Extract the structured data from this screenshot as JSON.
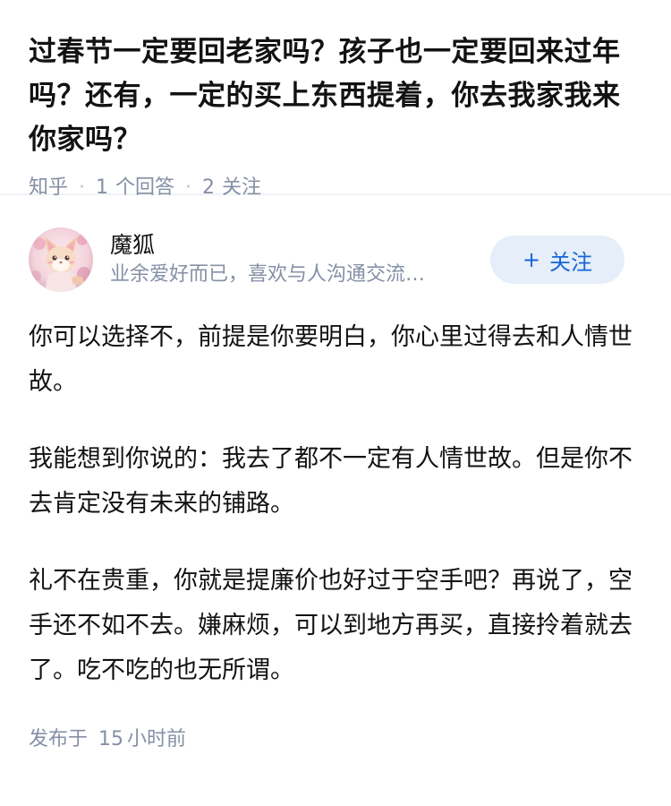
{
  "question": {
    "title": "过春节一定要回老家吗？孩子也一定要回来过年吗？还有，一定的买上东西提着，你去我家我来你家吗？",
    "source": "知乎",
    "answer_count": "1",
    "answer_label": "个回答",
    "follow_count": "2",
    "follow_label": "关注"
  },
  "answer": {
    "author": {
      "name": "魔狐",
      "bio": "业余爱好而已，喜欢与人沟通交流…",
      "avatar_icon": "fox-avatar"
    },
    "follow_button": {
      "plus": "+",
      "label": "关注"
    },
    "paragraphs": [
      "你可以选择不，前提是你要明白，你心里过得去和人情世故。",
      "我能想到你说的：我去了都不一定有人情世故。但是你不去肯定没有未来的铺路。",
      "礼不在贵重，你就是提廉价也好过于空手吧？再说了，空手还不如不去。嫌麻烦，可以到地方再买，直接拎着就去了。吃不吃的也无所谓。"
    ],
    "time": {
      "prefix": "发布于",
      "num": "15",
      "unit": "小时前"
    }
  },
  "colors": {
    "text": "#121212",
    "meta": "#8590a6",
    "follow_bg": "#e5eef9",
    "follow_text": "#1766d6"
  }
}
